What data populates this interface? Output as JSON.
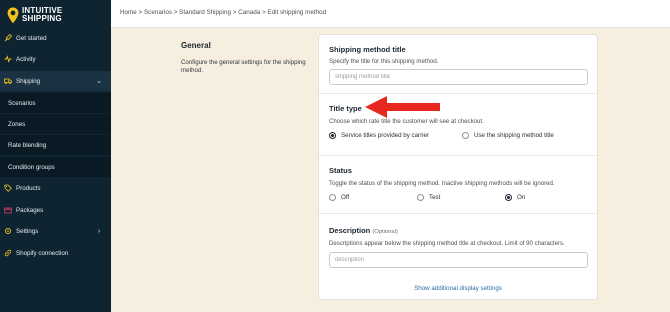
{
  "brand": {
    "line1": "INTUITIVE",
    "line2": "SHIPPING"
  },
  "colors": {
    "sidebar_bg": "#0f2431",
    "page_bg": "#f6eedf",
    "brand_accent": "#f4c21f",
    "arrow": "#e8281e",
    "link": "#2b6ea8"
  },
  "sidebar": {
    "items": [
      {
        "label": "Get started",
        "icon": "rocket-icon"
      },
      {
        "label": "Activity",
        "icon": "activity-icon"
      },
      {
        "label": "Shipping",
        "icon": "truck-icon",
        "chevron": "⌄"
      },
      {
        "label": "Scenarios"
      },
      {
        "label": "Zones"
      },
      {
        "label": "Rate blending"
      },
      {
        "label": "Condition groups"
      },
      {
        "label": "Products",
        "icon": "tag-icon"
      },
      {
        "label": "Packages",
        "icon": "package-icon"
      },
      {
        "label": "Settings",
        "icon": "gear-icon",
        "chevron": "›"
      },
      {
        "label": "Shopify connection",
        "icon": "link-icon"
      }
    ]
  },
  "breadcrumb": "Home > Scenarios > Standard Shipping > Canada > Edit shipping method",
  "general": {
    "title": "General",
    "description": "Configure the general settings for the shipping method."
  },
  "method_title": {
    "title": "Shipping method title",
    "description": "Specify the title for this shipping method.",
    "value": "",
    "placeholder": "shipping method title"
  },
  "title_type": {
    "title": "Title type",
    "description": "Choose which rate title the customer will see at checkout.",
    "options": [
      "Service titles provided by carrier",
      "Use the shipping method title"
    ],
    "selected": "Service titles provided by carrier"
  },
  "status": {
    "title": "Status",
    "description": "Toggle the status of the shipping method. Inactive shipping methods will be ignored.",
    "options": [
      "Off",
      "Test",
      "On"
    ],
    "selected": "On"
  },
  "description_field": {
    "title": "Description",
    "optional": "(Optional)",
    "description": "Descriptions appear below the shipping method title at checkout. Limit of 90 characters.",
    "value": "",
    "placeholder": "description"
  },
  "show_more_link": "Show additional display settings"
}
